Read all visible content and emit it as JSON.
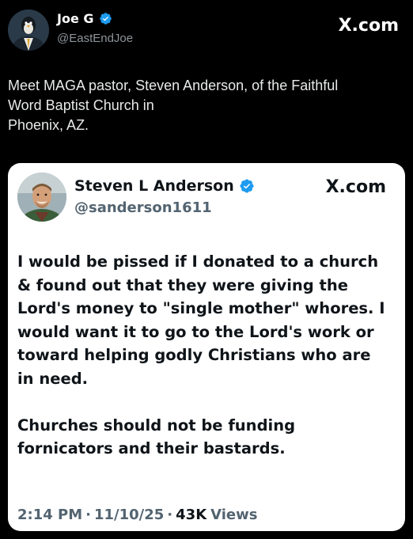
{
  "outer_tweet": {
    "display_name": "Joe G",
    "handle": "@EastEndJoe",
    "brand": "X.com",
    "text": "Meet MAGA pastor, Steven Anderson, of the Faithful\nWord Baptist Church in\nPhoenix, AZ."
  },
  "inner_tweet": {
    "display_name": "Steven L Anderson",
    "handle": "@sanderson1611",
    "brand": "X.com",
    "text": "I would be pissed if I donated to a church\n& found out that they were giving the\nLord's money to \"single mother\" whores. I\nwould want it to go to the Lord's work or\ntoward helping godly Christians who are\nin need.\n\nChurches should not be funding\nfornicators and their bastards.",
    "time": "2:14 PM",
    "date": "11/10/25",
    "views_count": "43K",
    "views_label": "Views"
  },
  "colors": {
    "verified": "#1d9bf0",
    "background": "#000000",
    "card": "#ffffff"
  },
  "icons": {
    "verified": "verified-badge-icon"
  }
}
